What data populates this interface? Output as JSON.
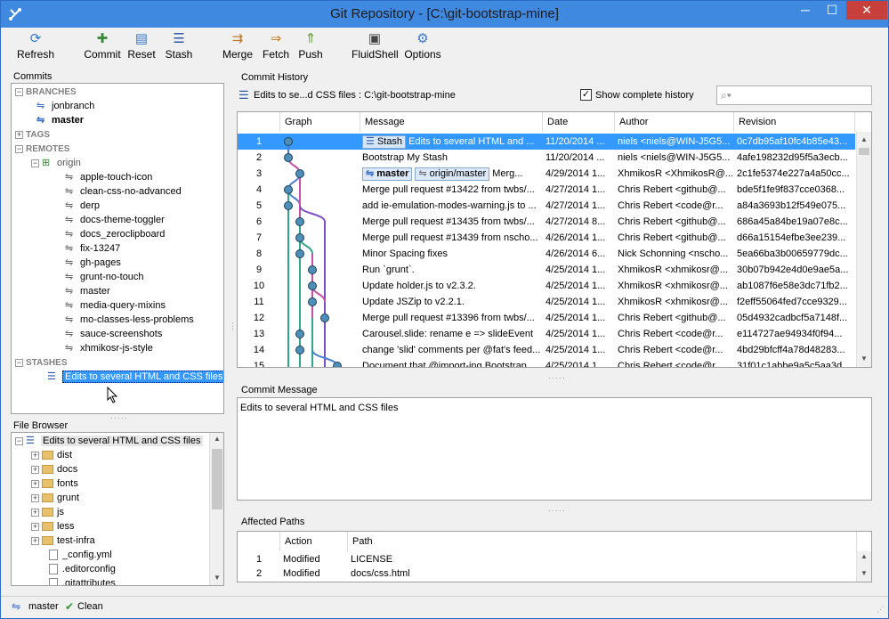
{
  "window": {
    "title": "Git Repository - [C:\\git-bootstrap-mine]",
    "minimize": "─",
    "maximize": "☐",
    "close": "✕"
  },
  "toolbar": {
    "refresh": "Refresh",
    "commit": "Commit",
    "reset": "Reset",
    "stash": "Stash",
    "merge": "Merge",
    "fetch": "Fetch",
    "push": "Push",
    "fluidshell": "FluidShell",
    "options": "Options"
  },
  "commits_panel": {
    "label": "Commits",
    "branches_header": "BRANCHES",
    "branches": [
      "jonbranch",
      "master"
    ],
    "tags_header": "TAGS",
    "remotes_header": "REMOTES",
    "remote_name": "origin",
    "remote_branches": [
      "apple-touch-icon",
      "clean-css-no-advanced",
      "derp",
      "docs-theme-toggler",
      "docs_zeroclipboard",
      "fix-13247",
      "gh-pages",
      "grunt-no-touch",
      "master",
      "media-query-mixins",
      "mo-classes-less-problems",
      "sauce-screenshots",
      "xhmikosr-js-style"
    ],
    "stashes_header": "STASHES",
    "stash_item": "Edits to several HTML and CSS files"
  },
  "file_browser": {
    "label": "File Browser",
    "root": "Edits to several HTML and CSS files",
    "folders": [
      "dist",
      "docs",
      "fonts",
      "grunt",
      "js",
      "less",
      "test-infra"
    ],
    "files": [
      "_config.yml",
      ".editorconfig",
      ".gitattributes"
    ]
  },
  "history": {
    "label": "Commit History",
    "path_text": "Edits to se...d CSS files : C:\\git-bootstrap-mine",
    "show_complete": "Show complete history",
    "search_placeholder": "",
    "columns": {
      "graph": "Graph",
      "message": "Message",
      "date": "Date",
      "author": "Author",
      "revision": "Revision"
    },
    "rows": [
      {
        "n": "1",
        "tag": "Stash",
        "msg": "Edits to several HTML and ...",
        "date": "11/20/2014 ...",
        "author": "niels <niels@WIN-J5G5...",
        "rev": "0c7db95af10fc4b85e43..."
      },
      {
        "n": "2",
        "tag": "",
        "msg": "Bootstrap My Stash",
        "date": "11/20/2014 ...",
        "author": "niels <niels@WIN-J5G5...",
        "rev": "4afe198232d95f5a3ecb..."
      },
      {
        "n": "3",
        "tag": "master",
        "tag2": "origin/master",
        "msg": "Merg...",
        "date": "4/29/2014 1...",
        "author": "XhmikosR <XhmikosR@...",
        "rev": "2c1fe5374e227a4a50cc..."
      },
      {
        "n": "4",
        "tag": "",
        "msg": "Merge pull request #13422 from twbs/...",
        "date": "4/27/2014 1...",
        "author": "Chris Rebert <github@...",
        "rev": "bde5f1fe9f837cce0368..."
      },
      {
        "n": "5",
        "tag": "",
        "msg": "add ie-emulation-modes-warning.js to ...",
        "date": "4/27/2014 1...",
        "author": "Chris Rebert <code@r...",
        "rev": "a84a3693b12f549e075..."
      },
      {
        "n": "6",
        "tag": "",
        "msg": "Merge pull request #13435 from twbs/...",
        "date": "4/27/2014 8...",
        "author": "Chris Rebert <github@...",
        "rev": "686a45a84be19a07e8c..."
      },
      {
        "n": "7",
        "tag": "",
        "msg": "Merge pull request #13439 from nscho...",
        "date": "4/26/2014 1...",
        "author": "Chris Rebert <github@...",
        "rev": "d66a15154efbe3ee239..."
      },
      {
        "n": "8",
        "tag": "",
        "msg": "Minor Spacing fixes",
        "date": "4/26/2014 6...",
        "author": "Nick Schonning <nscho...",
        "rev": "5ea66ba3b00659779dc..."
      },
      {
        "n": "9",
        "tag": "",
        "msg": "Run `grunt`.",
        "date": "4/25/2014 1...",
        "author": "XhmikosR <xhmikosr@...",
        "rev": "30b07b942e4d0e9ae5a..."
      },
      {
        "n": "10",
        "tag": "",
        "msg": "Update holder.js to v2.3.2.",
        "date": "4/25/2014 1...",
        "author": "XhmikosR <xhmikosr@...",
        "rev": "ab1087f6e58e3dc71fb2..."
      },
      {
        "n": "11",
        "tag": "",
        "msg": "Update JSZip to v2.2.1.",
        "date": "4/25/2014 1...",
        "author": "XhmikosR <xhmikosr@...",
        "rev": "f2eff55064fed7cce9329..."
      },
      {
        "n": "12",
        "tag": "",
        "msg": "Merge pull request #13396 from twbs/...",
        "date": "4/25/2014 1...",
        "author": "Chris Rebert <github@...",
        "rev": "05d4932cadbcf5a7148f..."
      },
      {
        "n": "13",
        "tag": "",
        "msg": "Carousel.slide: rename e => slideEvent",
        "date": "4/25/2014 1...",
        "author": "Chris Rebert <code@r...",
        "rev": "e114727ae94934f0f94..."
      },
      {
        "n": "14",
        "tag": "",
        "msg": "change 'slid' comments per @fat's feed...",
        "date": "4/25/2014 1...",
        "author": "Chris Rebert <code@r...",
        "rev": "4bd29bfcff4a78d48283..."
      },
      {
        "n": "15",
        "tag": "",
        "msg": "Document that @import-ing Bootstrap ...",
        "date": "4/25/2014 1...",
        "author": "Chris Rebert <code@r...",
        "rev": "31f01c1abbe9a5c5aa3d..."
      }
    ]
  },
  "commit_message": {
    "label": "Commit Message",
    "text": "Edits to several HTML and CSS files"
  },
  "affected_paths": {
    "label": "Affected Paths",
    "columns": {
      "action": "Action",
      "path": "Path"
    },
    "rows": [
      {
        "n": "1",
        "action": "Modified",
        "path": "LICENSE"
      },
      {
        "n": "2",
        "action": "Modified",
        "path": "docs/css.html"
      }
    ]
  },
  "status": {
    "branch": "master",
    "state": "Clean"
  },
  "colors": {
    "selection": "#3399ff",
    "titlebar": "#3f8ae0",
    "close": "#c7403b",
    "graph_blue": "#4a7fd0",
    "graph_pink": "#c84fa8",
    "graph_teal": "#2fa88a",
    "graph_purple": "#7a4fc8"
  }
}
